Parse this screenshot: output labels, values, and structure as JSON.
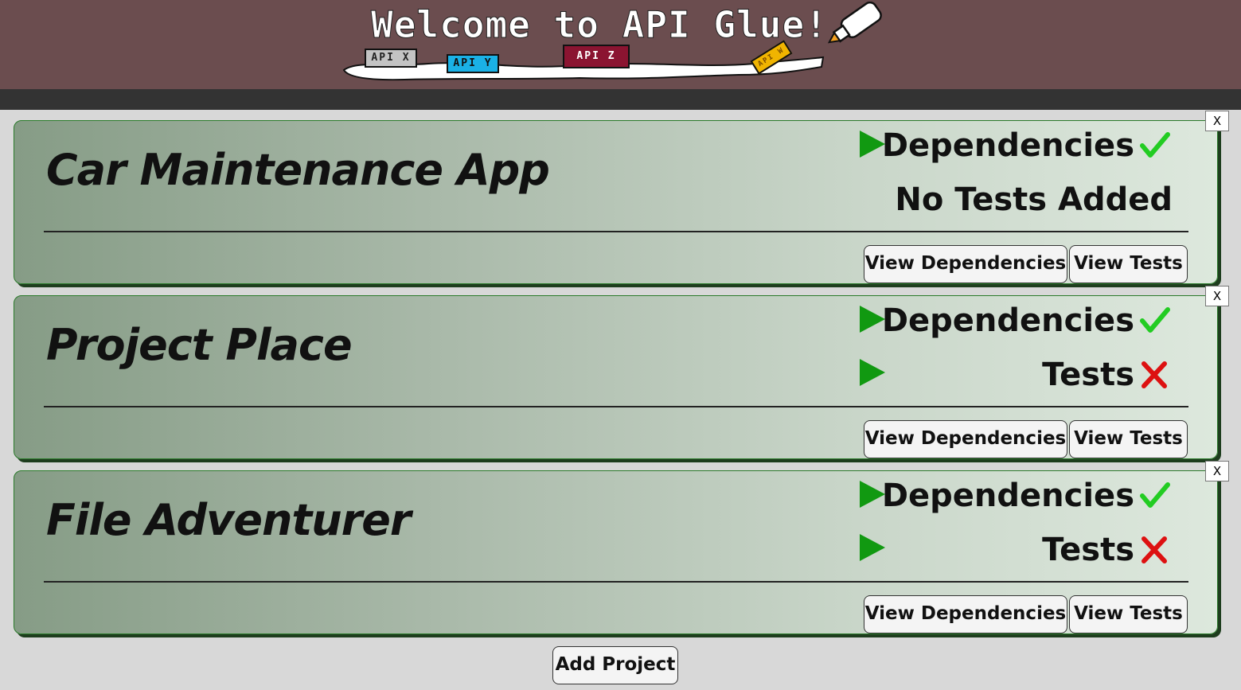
{
  "header": {
    "title": "Welcome to API Glue!",
    "tags": [
      "API X",
      "API Y",
      "API Z",
      "API W"
    ],
    "colors": {
      "background": "#6b4d4f",
      "strip": "#333333"
    }
  },
  "projects": [
    {
      "name": "Car Maintenance App",
      "close_label": "X",
      "dependencies": {
        "label": "Dependencies",
        "status": "pass",
        "icon": "check-icon"
      },
      "tests": {
        "label": "No Tests Added",
        "status": "none"
      },
      "view_dependencies_label": "View Dependencies",
      "view_tests_label": "View Tests"
    },
    {
      "name": "Project Place",
      "close_label": "X",
      "dependencies": {
        "label": "Dependencies",
        "status": "pass",
        "icon": "check-icon"
      },
      "tests": {
        "label": "Tests",
        "status": "fail",
        "icon": "cross-icon"
      },
      "view_dependencies_label": "View Dependencies",
      "view_tests_label": "View Tests"
    },
    {
      "name": "File Adventurer",
      "close_label": "X",
      "dependencies": {
        "label": "Dependencies",
        "status": "pass",
        "icon": "check-icon"
      },
      "tests": {
        "label": "Tests",
        "status": "fail",
        "icon": "cross-icon"
      },
      "view_dependencies_label": "View Dependencies",
      "view_tests_label": "View Tests"
    }
  ],
  "add_project_label": "Add Project",
  "colors": {
    "play": "#119911",
    "check": "#22cc22",
    "cross": "#dd1111",
    "card_border": "#2a7a2a"
  }
}
